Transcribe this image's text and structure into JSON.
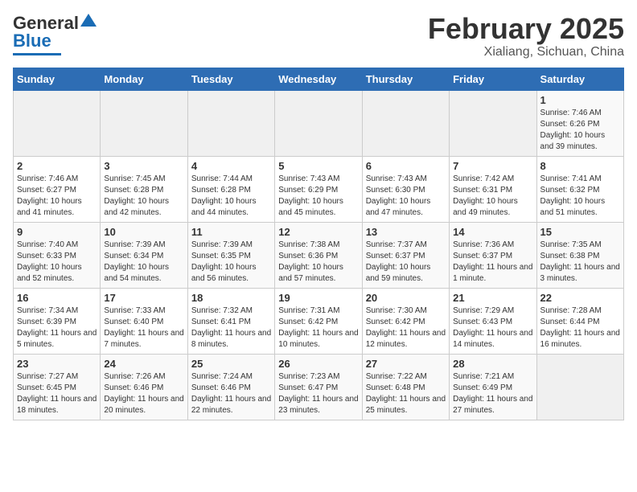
{
  "header": {
    "logo_line1": "General",
    "logo_line2": "Blue",
    "title": "February 2025",
    "subtitle": "Xialiang, Sichuan, China"
  },
  "calendar": {
    "weekdays": [
      "Sunday",
      "Monday",
      "Tuesday",
      "Wednesday",
      "Thursday",
      "Friday",
      "Saturday"
    ],
    "weeks": [
      [
        {
          "day": "",
          "info": ""
        },
        {
          "day": "",
          "info": ""
        },
        {
          "day": "",
          "info": ""
        },
        {
          "day": "",
          "info": ""
        },
        {
          "day": "",
          "info": ""
        },
        {
          "day": "",
          "info": ""
        },
        {
          "day": "1",
          "info": "Sunrise: 7:46 AM\nSunset: 6:26 PM\nDaylight: 10 hours and 39 minutes."
        }
      ],
      [
        {
          "day": "2",
          "info": "Sunrise: 7:46 AM\nSunset: 6:27 PM\nDaylight: 10 hours and 41 minutes."
        },
        {
          "day": "3",
          "info": "Sunrise: 7:45 AM\nSunset: 6:28 PM\nDaylight: 10 hours and 42 minutes."
        },
        {
          "day": "4",
          "info": "Sunrise: 7:44 AM\nSunset: 6:28 PM\nDaylight: 10 hours and 44 minutes."
        },
        {
          "day": "5",
          "info": "Sunrise: 7:43 AM\nSunset: 6:29 PM\nDaylight: 10 hours and 45 minutes."
        },
        {
          "day": "6",
          "info": "Sunrise: 7:43 AM\nSunset: 6:30 PM\nDaylight: 10 hours and 47 minutes."
        },
        {
          "day": "7",
          "info": "Sunrise: 7:42 AM\nSunset: 6:31 PM\nDaylight: 10 hours and 49 minutes."
        },
        {
          "day": "8",
          "info": "Sunrise: 7:41 AM\nSunset: 6:32 PM\nDaylight: 10 hours and 51 minutes."
        }
      ],
      [
        {
          "day": "9",
          "info": "Sunrise: 7:40 AM\nSunset: 6:33 PM\nDaylight: 10 hours and 52 minutes."
        },
        {
          "day": "10",
          "info": "Sunrise: 7:39 AM\nSunset: 6:34 PM\nDaylight: 10 hours and 54 minutes."
        },
        {
          "day": "11",
          "info": "Sunrise: 7:39 AM\nSunset: 6:35 PM\nDaylight: 10 hours and 56 minutes."
        },
        {
          "day": "12",
          "info": "Sunrise: 7:38 AM\nSunset: 6:36 PM\nDaylight: 10 hours and 57 minutes."
        },
        {
          "day": "13",
          "info": "Sunrise: 7:37 AM\nSunset: 6:37 PM\nDaylight: 10 hours and 59 minutes."
        },
        {
          "day": "14",
          "info": "Sunrise: 7:36 AM\nSunset: 6:37 PM\nDaylight: 11 hours and 1 minute."
        },
        {
          "day": "15",
          "info": "Sunrise: 7:35 AM\nSunset: 6:38 PM\nDaylight: 11 hours and 3 minutes."
        }
      ],
      [
        {
          "day": "16",
          "info": "Sunrise: 7:34 AM\nSunset: 6:39 PM\nDaylight: 11 hours and 5 minutes."
        },
        {
          "day": "17",
          "info": "Sunrise: 7:33 AM\nSunset: 6:40 PM\nDaylight: 11 hours and 7 minutes."
        },
        {
          "day": "18",
          "info": "Sunrise: 7:32 AM\nSunset: 6:41 PM\nDaylight: 11 hours and 8 minutes."
        },
        {
          "day": "19",
          "info": "Sunrise: 7:31 AM\nSunset: 6:42 PM\nDaylight: 11 hours and 10 minutes."
        },
        {
          "day": "20",
          "info": "Sunrise: 7:30 AM\nSunset: 6:42 PM\nDaylight: 11 hours and 12 minutes."
        },
        {
          "day": "21",
          "info": "Sunrise: 7:29 AM\nSunset: 6:43 PM\nDaylight: 11 hours and 14 minutes."
        },
        {
          "day": "22",
          "info": "Sunrise: 7:28 AM\nSunset: 6:44 PM\nDaylight: 11 hours and 16 minutes."
        }
      ],
      [
        {
          "day": "23",
          "info": "Sunrise: 7:27 AM\nSunset: 6:45 PM\nDaylight: 11 hours and 18 minutes."
        },
        {
          "day": "24",
          "info": "Sunrise: 7:26 AM\nSunset: 6:46 PM\nDaylight: 11 hours and 20 minutes."
        },
        {
          "day": "25",
          "info": "Sunrise: 7:24 AM\nSunset: 6:46 PM\nDaylight: 11 hours and 22 minutes."
        },
        {
          "day": "26",
          "info": "Sunrise: 7:23 AM\nSunset: 6:47 PM\nDaylight: 11 hours and 23 minutes."
        },
        {
          "day": "27",
          "info": "Sunrise: 7:22 AM\nSunset: 6:48 PM\nDaylight: 11 hours and 25 minutes."
        },
        {
          "day": "28",
          "info": "Sunrise: 7:21 AM\nSunset: 6:49 PM\nDaylight: 11 hours and 27 minutes."
        },
        {
          "day": "",
          "info": ""
        }
      ]
    ]
  }
}
